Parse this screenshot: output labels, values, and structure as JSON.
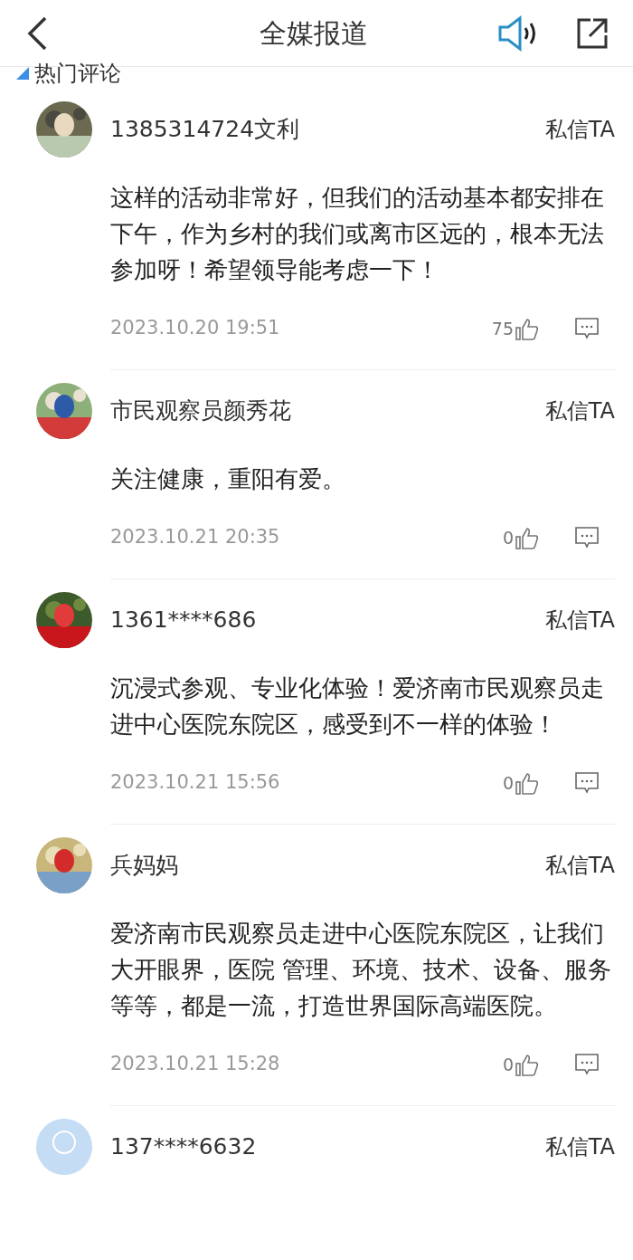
{
  "header": {
    "title": "全媒报道"
  },
  "section_title": "热门评论",
  "comments": [
    {
      "kind": "picture",
      "name": "1385314724文利",
      "message_button": "私信TA",
      "text": "这样的活动非常好，但我们的活动基本都安排在下午，作为乡村的我们或离市区远的，根本无法参加呀！希望领导能考虑一下！",
      "date": "2023.10.20 19:51",
      "likes": "75"
    },
    {
      "kind": "picture",
      "name": "市民观察员颜秀花",
      "message_button": "私信TA",
      "text": "关注健康，重阳有爱。",
      "date": "2023.10.21 20:35",
      "likes": "0"
    },
    {
      "kind": "picture",
      "name": "1361****686",
      "message_button": "私信TA",
      "text": "沉浸式参观、专业化体验！爱济南市民观察员走进中心医院东院区，感受到不一样的体验！",
      "date": "2023.10.21 15:56",
      "likes": "0"
    },
    {
      "kind": "picture",
      "name": "兵妈妈",
      "message_button": "私信TA",
      "text": "爱济南市民观察员走进中心医院东院区，让我们大开眼界，医院 管理、环境、技术、设备、服务等等，都是一流，打造世界国际高端医院。",
      "date": "2023.10.21 15:28",
      "likes": "0"
    },
    {
      "kind": "default",
      "name": "137****6632",
      "message_button": "私信TA"
    }
  ]
}
